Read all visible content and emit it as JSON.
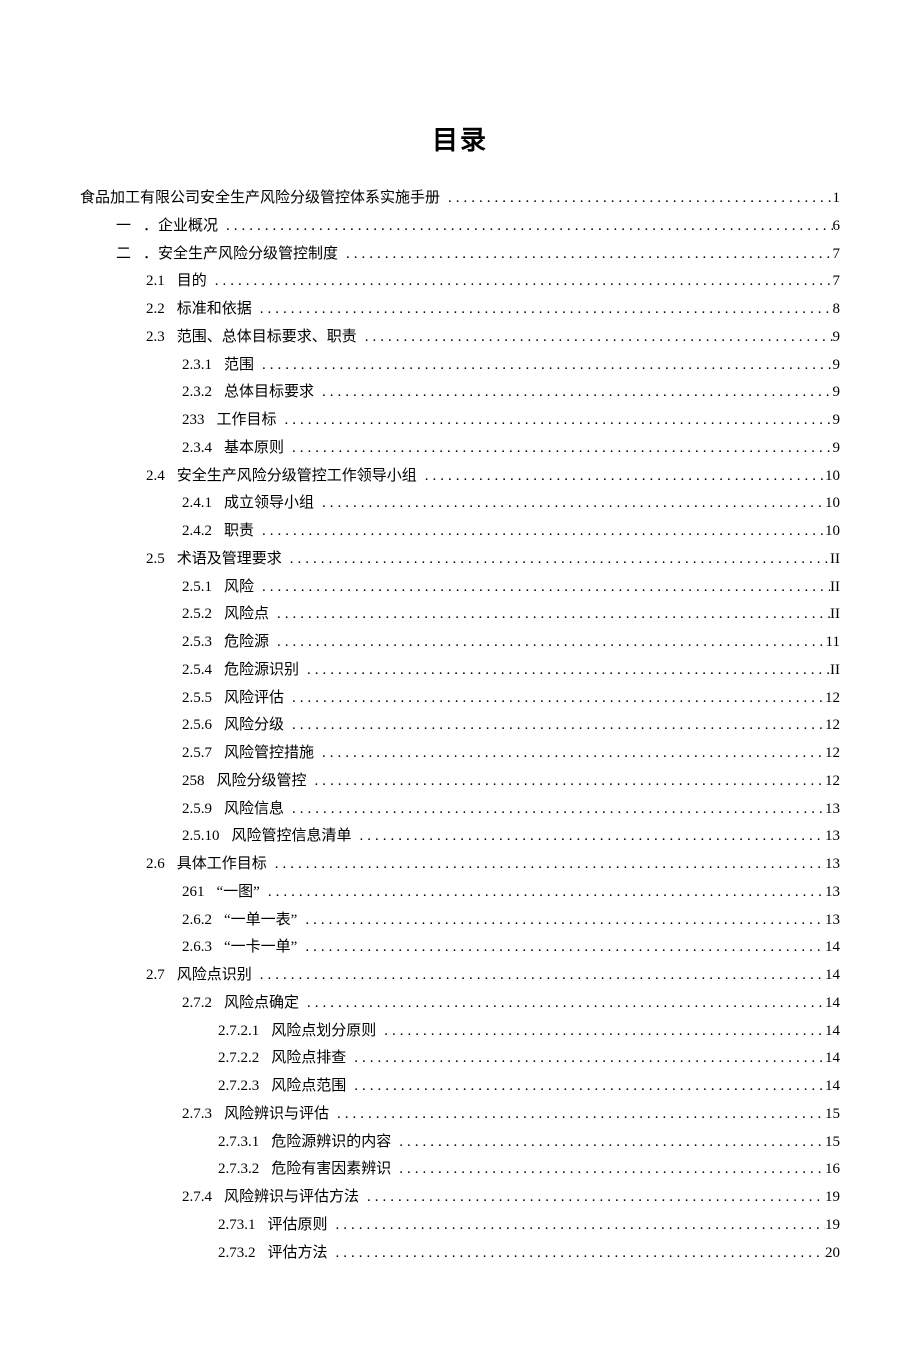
{
  "title": "目录",
  "entries": [
    {
      "indent": 0,
      "num": "",
      "label": "食品加工有限公司安全生产风险分级管控体系实施手册",
      "page": "1"
    },
    {
      "indent": 1,
      "num": "一",
      "label": "．企业概况",
      "page": "6"
    },
    {
      "indent": 1,
      "num": "二",
      "label": "．安全生产风险分级管控制度",
      "page": "7"
    },
    {
      "indent": 2,
      "num": "2.1",
      "label": "目的",
      "page": "7"
    },
    {
      "indent": 2,
      "num": "2.2",
      "label": "标准和依据",
      "page": "8"
    },
    {
      "indent": 2,
      "num": "2.3",
      "label": "范围、总体目标要求、职责",
      "page": "9"
    },
    {
      "indent": 3,
      "num": "2.3.1",
      "label": "范围",
      "page": "9"
    },
    {
      "indent": 3,
      "num": "2.3.2",
      "label": "总体目标要求",
      "page": "9"
    },
    {
      "indent": 3,
      "num": "233",
      "label": "工作目标",
      "page": "9"
    },
    {
      "indent": 3,
      "num": "2.3.4",
      "label": "基本原则",
      "page": "9"
    },
    {
      "indent": 2,
      "num": "2.4",
      "label": "安全生产风险分级管控工作领导小组",
      "page": "10"
    },
    {
      "indent": 3,
      "num": "2.4.1",
      "label": "成立领导小组",
      "page": "10"
    },
    {
      "indent": 3,
      "num": "2.4.2",
      "label": "职责",
      "page": "10"
    },
    {
      "indent": 2,
      "num": "2.5",
      "label": "术语及管理要求",
      "page": "II"
    },
    {
      "indent": 3,
      "num": "2.5.1",
      "label": "风险",
      "page": "II"
    },
    {
      "indent": 3,
      "num": "2.5.2",
      "label": "风险点",
      "page": "II"
    },
    {
      "indent": 3,
      "num": "2.5.3",
      "label": "危险源",
      "page": "11"
    },
    {
      "indent": 3,
      "num": "2.5.4",
      "label": "危险源识别",
      "page": "II"
    },
    {
      "indent": 3,
      "num": "2.5.5",
      "label": "风险评估",
      "page": "12"
    },
    {
      "indent": 3,
      "num": "2.5.6",
      "label": "风险分级",
      "page": "12"
    },
    {
      "indent": 3,
      "num": "2.5.7",
      "label": "风险管控措施",
      "page": "12"
    },
    {
      "indent": 3,
      "num": "258",
      "label": "风险分级管控",
      "page": "12"
    },
    {
      "indent": 3,
      "num": "2.5.9",
      "label": "风险信息",
      "page": "13"
    },
    {
      "indent": 3,
      "num": "2.5.10",
      "label": "风险管控信息清单",
      "page": "13"
    },
    {
      "indent": 2,
      "num": "2.6",
      "label": "具体工作目标",
      "page": "13"
    },
    {
      "indent": 3,
      "num": "261",
      "label": "“一图”",
      "page": "13"
    },
    {
      "indent": 3,
      "num": "2.6.2",
      "label": "“一单一表”",
      "page": "13"
    },
    {
      "indent": 3,
      "num": "2.6.3",
      "label": "“一卡一单”",
      "page": "14"
    },
    {
      "indent": 2,
      "num": "2.7",
      "label": "风险点识别",
      "page": "14"
    },
    {
      "indent": 3,
      "num": "2.7.2",
      "label": "风险点确定",
      "page": "14"
    },
    {
      "indent": 4,
      "num": "2.7.2.1",
      "label": "风险点划分原则",
      "page": "14"
    },
    {
      "indent": 4,
      "num": "2.7.2.2",
      "label": "风险点排查",
      "page": "14"
    },
    {
      "indent": 4,
      "num": "2.7.2.3",
      "label": "风险点范围",
      "page": "14"
    },
    {
      "indent": 3,
      "num": "2.7.3",
      "label": "风险辨识与评估",
      "page": "15"
    },
    {
      "indent": 4,
      "num": "2.7.3.1",
      "label": "危险源辨识的内容",
      "page": "15"
    },
    {
      "indent": 4,
      "num": "2.7.3.2",
      "label": "危险有害因素辨识",
      "page": "16"
    },
    {
      "indent": 3,
      "num": "2.7.4",
      "label": "风险辨识与评估方法",
      "page": "19"
    },
    {
      "indent": 4,
      "num": "2.73.1",
      "label": "评估原则",
      "page": "19"
    },
    {
      "indent": 4,
      "num": "2.73.2",
      "label": "评估方法",
      "page": "20"
    }
  ]
}
